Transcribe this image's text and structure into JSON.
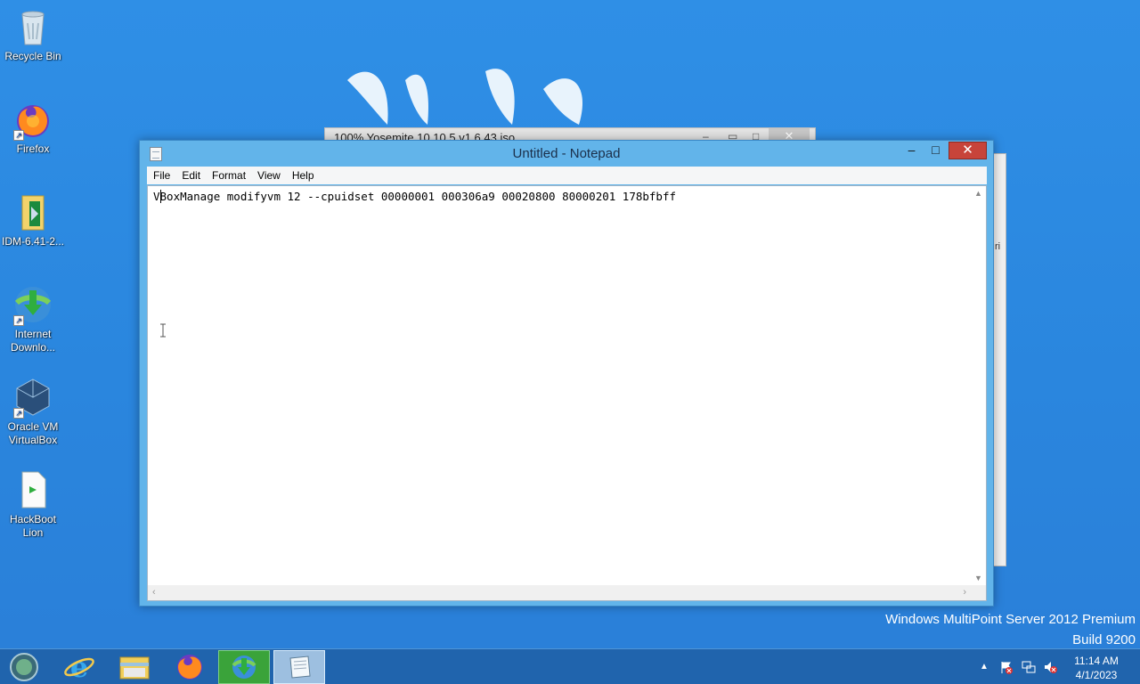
{
  "desktop": {
    "icons": [
      {
        "label": "Recycle Bin",
        "icon": "recycle-bin-icon"
      },
      {
        "label": "Firefox",
        "icon": "firefox-icon"
      },
      {
        "label": "IDM-6.41-2...",
        "icon": "folder-icon"
      },
      {
        "label": "Internet Downlo...",
        "icon": "idm-icon"
      },
      {
        "label": "Oracle VM VirtualBox",
        "icon": "virtualbox-icon"
      },
      {
        "label": "HackBoot Lion",
        "icon": "file-icon"
      }
    ]
  },
  "background_window": {
    "title": "100% Yosemite 10.10.5 v1.6.43.iso",
    "side_text": "ri"
  },
  "notepad": {
    "title": "Untitled - Notepad",
    "controls": {
      "minimize": "–",
      "maximize": "□",
      "close": "✕"
    },
    "menu": [
      "File",
      "Edit",
      "Format",
      "View",
      "Help"
    ],
    "content": "VBoxManage modifyvm 12 --cpuidset 00000001 000306a9 00020800 80000201 178bfbff"
  },
  "watermark": {
    "line1": "Windows MultiPoint Server 2012 Premium",
    "line2": "Build 9200"
  },
  "taskbar": {
    "pinned": [
      {
        "name": "internet-explorer",
        "icon": "ie-icon"
      },
      {
        "name": "file-explorer",
        "icon": "folder-icon"
      },
      {
        "name": "firefox",
        "icon": "firefox-icon"
      },
      {
        "name": "internet-download-manager",
        "icon": "idm-icon",
        "active": true
      },
      {
        "name": "notepad",
        "icon": "notepad-icon",
        "active": true
      }
    ],
    "clock": {
      "time": "11:14 AM",
      "date": "4/1/2023"
    }
  },
  "colors": {
    "desktop_bg": "#2a86de",
    "close_button": "#c7443a",
    "window_frame": "#62b4ea"
  }
}
